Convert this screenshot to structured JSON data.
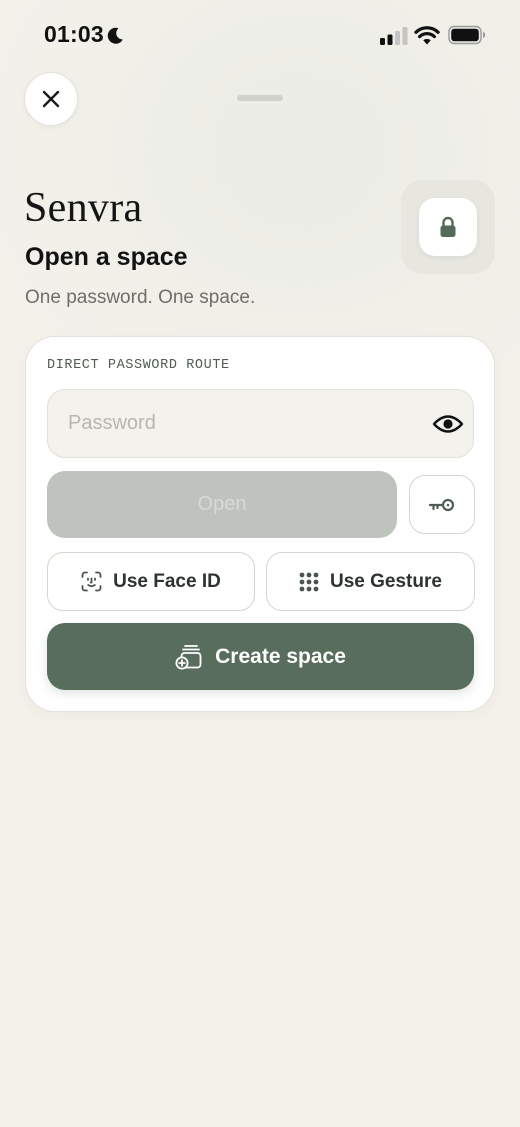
{
  "status_bar": {
    "time": "01:03"
  },
  "header": {
    "app_name": "Senvra",
    "title": "Open a space",
    "subtitle": "One password. One space."
  },
  "card": {
    "section_label": "DIRECT PASSWORD ROUTE",
    "password_field": {
      "value": "",
      "placeholder": "Password"
    },
    "open_label": "Open",
    "face_id_label": "Use Face ID",
    "gesture_label": "Use Gesture",
    "create_label": "Create space"
  },
  "icons": {
    "close": "close-icon",
    "lock": "lock-icon",
    "eye": "eye-icon",
    "key": "key-icon",
    "face_id": "face-id-icon",
    "gesture": "grid-dots-icon",
    "create": "stack-add-icon"
  },
  "colors": {
    "background": "#f3f1ea",
    "accent": "#586d5c",
    "disabled_button": "#bec3bd",
    "field_background": "#f4f2ec"
  }
}
